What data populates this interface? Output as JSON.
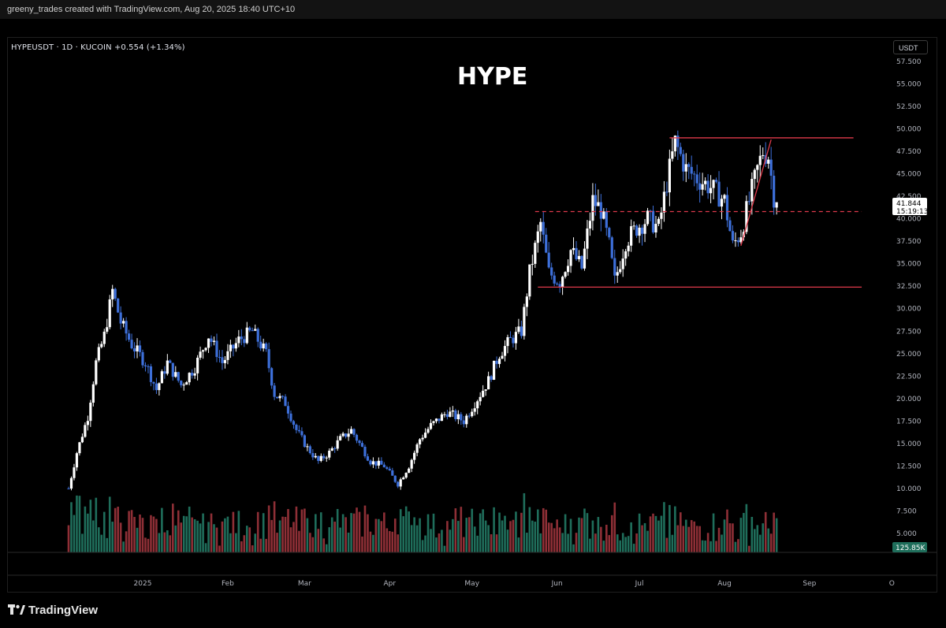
{
  "header": {
    "attribution": "greeny_trades created with TradingView.com, Aug 20, 2025 18:40 UTC+10"
  },
  "chart_meta": {
    "symbol_line": "HYPEUSDT · 1D · KUCOIN  +0.554 (+1.34%)",
    "title": "HYPE",
    "currency": "USDT"
  },
  "price_label": {
    "value": "41.844",
    "countdown": "15:19:13"
  },
  "volume_label": "125.85K",
  "footer": {
    "brand": "TradingView"
  },
  "colors": {
    "up_candle": "#ffffff",
    "down_candle": "#3d6fd9",
    "vol_up": "#1f6e5b",
    "vol_down": "#8e2f36",
    "lines": "#e03a4b"
  },
  "chart_data": {
    "type": "candlestick",
    "symbol": "HYPEUSDT",
    "timeframe": "1D",
    "exchange": "KUCOIN",
    "title": "HYPE",
    "ylim": [
      0,
      60
    ],
    "y_ticks": [
      "57.500",
      "55.000",
      "52.500",
      "50.000",
      "47.500",
      "45.000",
      "42.500",
      "40.000",
      "37.500",
      "35.000",
      "32.500",
      "30.000",
      "27.500",
      "25.000",
      "22.500",
      "20.000",
      "17.500",
      "15.000",
      "12.500",
      "10.000",
      "7.500",
      "5.000"
    ],
    "x_ticks": [
      "2025",
      "Feb",
      "Mar",
      "Apr",
      "May",
      "Jun",
      "Jul",
      "Aug",
      "Sep",
      "O"
    ],
    "last_price": 41.844,
    "horizontal_lines": [
      {
        "style": "solid",
        "value": 49.0,
        "start": "2025-07-12",
        "end": "2025-09-17"
      },
      {
        "style": "dashed",
        "value": 40.8,
        "start": "2025-05-24",
        "end": "2025-09-20"
      },
      {
        "style": "solid",
        "value": 32.4,
        "start": "2025-05-25",
        "end": "2025-09-20"
      }
    ],
    "trend_lines": [
      {
        "x1": "2025-08-07",
        "y1": 37.0,
        "x2": "2025-08-18",
        "y2": 48.8
      }
    ],
    "approx_path": [
      [
        "2024-12-05",
        10.0
      ],
      [
        "2024-12-08",
        14.0
      ],
      [
        "2024-12-12",
        18.0
      ],
      [
        "2024-12-15",
        24.0
      ],
      [
        "2024-12-18",
        27.0
      ],
      [
        "2024-12-21",
        32.0
      ],
      [
        "2024-12-24",
        28.5
      ],
      [
        "2024-12-28",
        26.0
      ],
      [
        "2025-01-02",
        24.0
      ],
      [
        "2025-01-06",
        21.0
      ],
      [
        "2025-01-10",
        24.0
      ],
      [
        "2025-01-15",
        21.5
      ],
      [
        "2025-01-20",
        23.5
      ],
      [
        "2025-01-25",
        27.0
      ],
      [
        "2025-01-30",
        24.0
      ],
      [
        "2025-02-05",
        26.5
      ],
      [
        "2025-02-10",
        27.5
      ],
      [
        "2025-02-15",
        25.0
      ],
      [
        "2025-02-18",
        20.5
      ],
      [
        "2025-02-22",
        19.5
      ],
      [
        "2025-02-26",
        16.5
      ],
      [
        "2025-03-02",
        14.5
      ],
      [
        "2025-03-06",
        13.0
      ],
      [
        "2025-03-10",
        14.0
      ],
      [
        "2025-03-14",
        15.5
      ],
      [
        "2025-03-18",
        16.5
      ],
      [
        "2025-03-21",
        15.0
      ],
      [
        "2025-03-25",
        13.0
      ],
      [
        "2025-03-30",
        12.5
      ],
      [
        "2025-04-04",
        10.5
      ],
      [
        "2025-04-08",
        12.5
      ],
      [
        "2025-04-12",
        15.5
      ],
      [
        "2025-04-16",
        17.0
      ],
      [
        "2025-04-22",
        18.5
      ],
      [
        "2025-04-28",
        17.5
      ],
      [
        "2025-05-03",
        20.0
      ],
      [
        "2025-05-07",
        22.0
      ],
      [
        "2025-05-11",
        25.0
      ],
      [
        "2025-05-15",
        26.5
      ],
      [
        "2025-05-19",
        27.5
      ],
      [
        "2025-05-22",
        34.0
      ],
      [
        "2025-05-26",
        39.5
      ],
      [
        "2025-05-29",
        34.0
      ],
      [
        "2025-06-02",
        33.0
      ],
      [
        "2025-06-06",
        36.5
      ],
      [
        "2025-06-10",
        34.5
      ],
      [
        "2025-06-14",
        42.0
      ],
      [
        "2025-06-17",
        41.0
      ],
      [
        "2025-06-20",
        37.0
      ],
      [
        "2025-06-22",
        33.0
      ],
      [
        "2025-06-26",
        37.5
      ],
      [
        "2025-06-30",
        39.0
      ],
      [
        "2025-07-04",
        40.0
      ],
      [
        "2025-07-08",
        39.0
      ],
      [
        "2025-07-11",
        44.0
      ],
      [
        "2025-07-14",
        48.5
      ],
      [
        "2025-07-18",
        45.5
      ],
      [
        "2025-07-22",
        44.5
      ],
      [
        "2025-07-27",
        43.5
      ],
      [
        "2025-08-01",
        42.0
      ],
      [
        "2025-08-04",
        37.0
      ],
      [
        "2025-08-07",
        38.5
      ],
      [
        "2025-08-10",
        42.0
      ],
      [
        "2025-08-13",
        45.5
      ],
      [
        "2025-08-15",
        47.5
      ],
      [
        "2025-08-17",
        47.0
      ],
      [
        "2025-08-19",
        42.5
      ],
      [
        "2025-08-20",
        41.8
      ]
    ]
  }
}
